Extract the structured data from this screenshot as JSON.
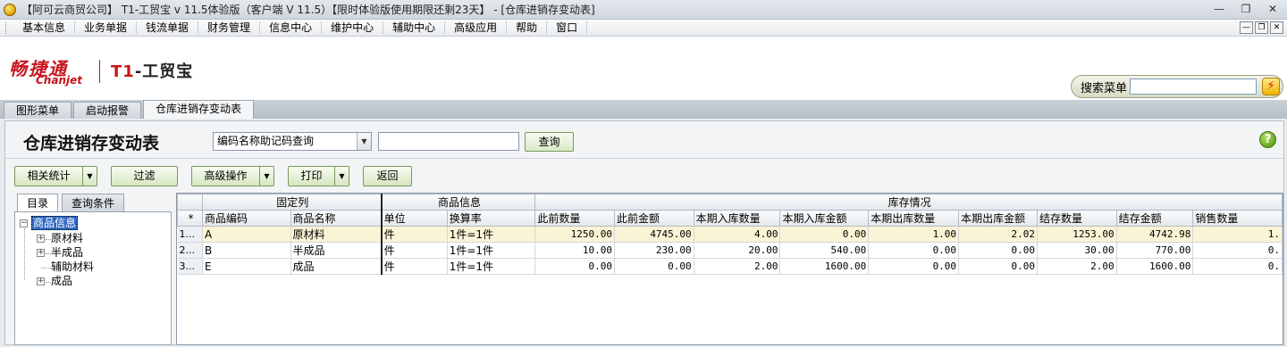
{
  "window": {
    "title": "【阿可云商贸公司】 T1-工贸宝 v 11.5体验版（客户端 V 11.5）【限时体验版使用期限还剩23天】 - [仓库进销存变动表]",
    "controls": [
      "—",
      "❐",
      "✕"
    ]
  },
  "menubar": {
    "items": [
      "基本信息",
      "业务单据",
      "钱流单据",
      "财务管理",
      "信息中心",
      "维护中心",
      "辅助中心",
      "高级应用",
      "帮助",
      "窗口"
    ],
    "mdi_controls": [
      "—",
      "❐",
      "✕"
    ]
  },
  "brand": {
    "logo_cn": "畅捷通",
    "logo_en": "Chanjet",
    "product_prefix": "T1",
    "product_suffix": "-工贸宝",
    "search_label": "搜索菜单",
    "search_placeholder": "",
    "search_go": "⚡"
  },
  "tabs": [
    {
      "label": "图形菜单",
      "active": false
    },
    {
      "label": "启动报警",
      "active": false
    },
    {
      "label": "仓库进销存变动表",
      "active": true
    }
  ],
  "page": {
    "title": "仓库进销存变动表",
    "query_select": "编码名称助记码查询",
    "query_value": "",
    "query_button": "查询",
    "help": "?"
  },
  "toolbar": {
    "stats": "相关统计",
    "filter": "过滤",
    "advanced": "高级操作",
    "print": "打印",
    "back": "返回"
  },
  "left": {
    "tabs": [
      "目录",
      "查询条件"
    ],
    "tree": {
      "root": "商品信息",
      "children": [
        {
          "label": "原材料",
          "expandable": true
        },
        {
          "label": "半成品",
          "expandable": true
        },
        {
          "label": "辅助材料",
          "expandable": false
        },
        {
          "label": "成品",
          "expandable": true
        }
      ]
    }
  },
  "grid": {
    "groups": {
      "fixed": "固定列",
      "goods": "商品信息",
      "stock": "库存情况"
    },
    "star": "*",
    "columns": [
      "商品编码",
      "商品名称",
      "单位",
      "换算率",
      "此前数量",
      "此前金额",
      "本期入库数量",
      "本期入库金额",
      "本期出库数量",
      "本期出库金额",
      "结存数量",
      "结存金额",
      "销售数量"
    ],
    "rows": [
      {
        "rn": "1...",
        "cells": [
          "A",
          "原材料",
          "件",
          "1件=1件",
          "1250.00",
          "4745.00",
          "4.00",
          "0.00",
          "1.00",
          "2.02",
          "1253.00",
          "4742.98",
          "1."
        ]
      },
      {
        "rn": "2...",
        "cells": [
          "B",
          "半成品",
          "件",
          "1件=1件",
          "10.00",
          "230.00",
          "20.00",
          "540.00",
          "0.00",
          "0.00",
          "30.00",
          "770.00",
          "0."
        ]
      },
      {
        "rn": "3...",
        "cells": [
          "E",
          "成品",
          "件",
          "1件=1件",
          "0.00",
          "0.00",
          "2.00",
          "1600.00",
          "0.00",
          "0.00",
          "2.00",
          "1600.00",
          "0."
        ]
      }
    ]
  },
  "colors": {
    "brand_red": "#c8141c",
    "selection_blue": "#316ac5",
    "button_green": "#7a9a5a"
  }
}
